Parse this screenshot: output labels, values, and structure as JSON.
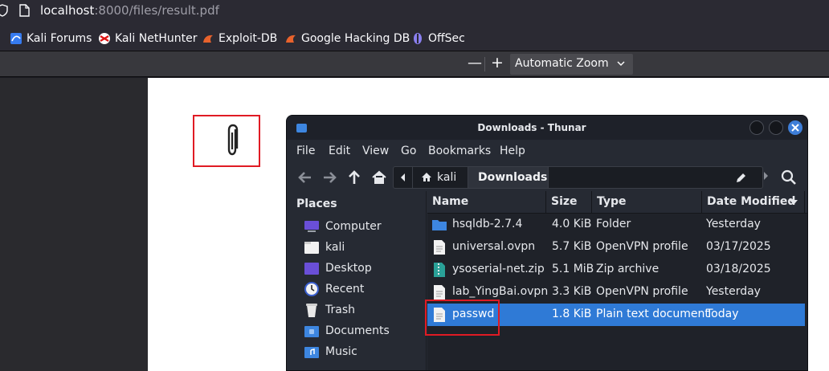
{
  "browser": {
    "url_host": "localhost",
    "url_rest": ":8000/files/result.pdf",
    "bookmarks": [
      {
        "label": "Kali Forums",
        "icon": "kali-dragon-icon"
      },
      {
        "label": "Kali NetHunter",
        "icon": "nethunter-icon"
      },
      {
        "label": "Exploit-DB",
        "icon": "exploit-db-icon"
      },
      {
        "label": "Google Hacking DB",
        "icon": "ghdb-icon"
      },
      {
        "label": "OffSec",
        "icon": "offsec-icon"
      }
    ]
  },
  "pdf_toolbar": {
    "zoom_out": "—",
    "zoom_in": "+",
    "zoom_value": "Automatic Zoom"
  },
  "pdf_page": {
    "attachment_icon": "paperclip-icon"
  },
  "thunar": {
    "title": "Downloads - Thunar",
    "menu": [
      "File",
      "Edit",
      "View",
      "Go",
      "Bookmarks",
      "Help"
    ],
    "path": [
      "kali",
      "Downloads"
    ],
    "places_header": "Places",
    "places": [
      {
        "label": "Computer",
        "icon": "computer-icon"
      },
      {
        "label": "kali",
        "icon": "home-folder-icon"
      },
      {
        "label": "Desktop",
        "icon": "desktop-icon"
      },
      {
        "label": "Recent",
        "icon": "recent-icon"
      },
      {
        "label": "Trash",
        "icon": "trash-icon"
      },
      {
        "label": "Documents",
        "icon": "documents-folder-icon"
      },
      {
        "label": "Music",
        "icon": "music-folder-icon"
      }
    ],
    "columns": [
      "Name",
      "Size",
      "Type",
      "Date Modified"
    ],
    "files": [
      {
        "name": "hsqldb-2.7.4",
        "size": "4.0 KiB",
        "type": "Folder",
        "date": "Yesterday",
        "icon": "folder-icon",
        "selected": false
      },
      {
        "name": "universal.ovpn",
        "size": "5.7 KiB",
        "type": "OpenVPN profile",
        "date": "03/17/2025",
        "icon": "text-file-icon",
        "selected": false
      },
      {
        "name": "ysoserial-net.zip",
        "size": "5.1 MiB",
        "type": "Zip archive",
        "date": "03/18/2025",
        "icon": "zip-file-icon",
        "selected": false
      },
      {
        "name": "lab_YingBai.ovpn",
        "size": "3.3 KiB",
        "type": "OpenVPN profile",
        "date": "Yesterday",
        "icon": "text-file-icon",
        "selected": false
      },
      {
        "name": "passwd",
        "size": "1.8 KiB",
        "type": "Plain text document",
        "date": "Today",
        "icon": "text-file-icon",
        "selected": true
      }
    ],
    "colors": {
      "selection": "#2f7ad6",
      "highlight_box": "#e01b24"
    }
  }
}
